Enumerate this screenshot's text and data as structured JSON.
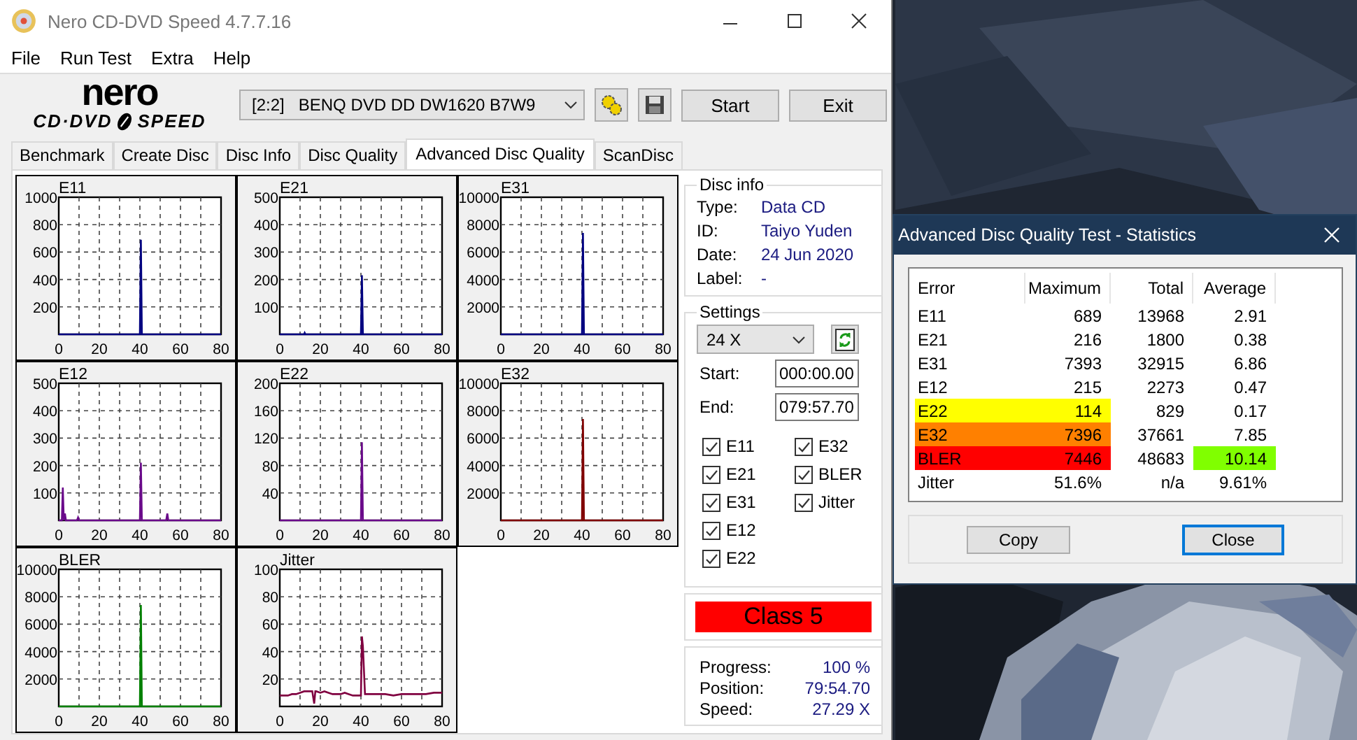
{
  "window": {
    "title": "Nero CD-DVD Speed 4.7.7.16"
  },
  "menu": [
    "File",
    "Run Test",
    "Extra",
    "Help"
  ],
  "logo": {
    "brand": "nero",
    "left": "CD·DVD",
    "right": "SPEED"
  },
  "toolbar": {
    "drive": "[2:2]   BENQ DVD DD DW1620 B7W9",
    "buttons": [
      "Start",
      "Exit"
    ]
  },
  "tabs": [
    {
      "label": "Benchmark",
      "selected": false
    },
    {
      "label": "Create Disc",
      "selected": false
    },
    {
      "label": "Disc Info",
      "selected": false
    },
    {
      "label": "Disc Quality",
      "selected": false
    },
    {
      "label": "Advanced Disc Quality",
      "selected": true
    },
    {
      "label": "ScanDisc",
      "selected": false
    }
  ],
  "charts": [
    {
      "chart_data": {
        "type": "line",
        "title": "E11",
        "x": [
          0,
          40,
          40.5,
          41,
          80
        ],
        "series": [
          {
            "color": "#000080",
            "values": [
              0,
              0,
              690,
              0,
              0
            ]
          }
        ],
        "grid": true,
        "xlim": [
          0,
          80
        ],
        "ylim": [
          0,
          1000
        ],
        "xticks": [
          0,
          20,
          40,
          60,
          80
        ],
        "yticks": [
          200,
          400,
          600,
          800,
          1000
        ]
      }
    },
    {
      "chart_data": {
        "type": "line",
        "title": "E21",
        "x": [
          0,
          12,
          12.3,
          12.6,
          40,
          40.5,
          41,
          80
        ],
        "series": [
          {
            "color": "#000080",
            "values": [
              0,
              0,
              5,
              0,
              0,
              216,
              0,
              0
            ]
          }
        ],
        "grid": true,
        "xlim": [
          0,
          80
        ],
        "ylim": [
          0,
          500
        ],
        "xticks": [
          0,
          20,
          40,
          60,
          80
        ],
        "yticks": [
          100,
          200,
          300,
          400,
          500
        ]
      }
    },
    {
      "chart_data": {
        "type": "line",
        "title": "E31",
        "x": [
          0,
          40,
          40.5,
          41,
          80
        ],
        "series": [
          {
            "color": "#000080",
            "values": [
              0,
              0,
              7400,
              0,
              0
            ]
          }
        ],
        "grid": true,
        "xlim": [
          0,
          80
        ],
        "ylim": [
          0,
          10000
        ],
        "xticks": [
          0,
          20,
          40,
          60,
          80
        ],
        "yticks": [
          2000,
          4000,
          6000,
          8000,
          10000
        ]
      }
    },
    {
      "chart_data": {
        "type": "line",
        "title": "E12",
        "x": [
          0,
          1.5,
          2,
          2.5,
          3,
          3.5,
          9,
          9.5,
          10,
          40,
          40.5,
          41,
          53,
          53.5,
          54,
          80
        ],
        "series": [
          {
            "color": "#6a0a8a",
            "values": [
              0,
              0,
              120,
              0,
              25,
              0,
              0,
              10,
              0,
              0,
              210,
              0,
              0,
              25,
              0,
              0
            ]
          }
        ],
        "grid": true,
        "xlim": [
          0,
          80
        ],
        "ylim": [
          0,
          500
        ],
        "xticks": [
          0,
          20,
          40,
          60,
          80
        ],
        "yticks": [
          100,
          200,
          300,
          400,
          500
        ]
      }
    },
    {
      "chart_data": {
        "type": "line",
        "title": "E22",
        "x": [
          0,
          40,
          40.5,
          41,
          80
        ],
        "series": [
          {
            "color": "#6a0a8a",
            "values": [
              0,
              0,
              114,
              0,
              0
            ]
          }
        ],
        "grid": true,
        "xlim": [
          0,
          80
        ],
        "ylim": [
          0,
          200
        ],
        "xticks": [
          0,
          20,
          40,
          60,
          80
        ],
        "yticks": [
          40,
          80,
          120,
          160,
          200
        ]
      }
    },
    {
      "chart_data": {
        "type": "line",
        "title": "E32",
        "x": [
          0,
          40,
          40.5,
          41,
          80
        ],
        "series": [
          {
            "color": "#800000",
            "values": [
              0,
              0,
              7400,
              0,
              0
            ]
          }
        ],
        "grid": true,
        "xlim": [
          0,
          80
        ],
        "ylim": [
          0,
          10000
        ],
        "xticks": [
          0,
          20,
          40,
          60,
          80
        ],
        "yticks": [
          2000,
          4000,
          6000,
          8000,
          10000
        ]
      }
    },
    {
      "chart_data": {
        "type": "line",
        "title": "BLER",
        "x": [
          0,
          40,
          40.5,
          41,
          80
        ],
        "series": [
          {
            "color": "#008000",
            "values": [
              0,
              0,
              7400,
              0,
              0
            ]
          }
        ],
        "grid": true,
        "xlim": [
          0,
          80
        ],
        "ylim": [
          0,
          10000
        ],
        "xticks": [
          0,
          20,
          40,
          60,
          80
        ],
        "yticks": [
          2000,
          4000,
          6000,
          8000,
          10000
        ]
      }
    },
    {
      "chart_data": {
        "type": "line",
        "title": "Jitter",
        "x": [
          0,
          2,
          4,
          6,
          8,
          10,
          12,
          14,
          16,
          17,
          17.5,
          18,
          20,
          22,
          24,
          26,
          28,
          30,
          32,
          34,
          36,
          38,
          40,
          40.5,
          41,
          42,
          43,
          44,
          48,
          52,
          56,
          60,
          64,
          68,
          72,
          76,
          80
        ],
        "series": [
          {
            "color": "#800040",
            "values": [
              8,
              8,
              8,
              9,
              9,
              10,
              11,
              11,
              11,
              2,
              11,
              11,
              10,
              11,
              10,
              9,
              9,
              9,
              10,
              9,
              8,
              8,
              8,
              51,
              44,
              9,
              9,
              9,
              9,
              9,
              8,
              9,
              9,
              9,
              9,
              10,
              10
            ]
          }
        ],
        "grid": true,
        "xlim": [
          0,
          80
        ],
        "ylim": [
          0,
          100
        ],
        "xticks": [
          0,
          20,
          40,
          60,
          80
        ],
        "yticks": [
          20,
          40,
          60,
          80,
          100
        ]
      }
    }
  ],
  "disc_info": {
    "title": "Disc info",
    "fields": [
      {
        "label": "Type:",
        "value": "Data CD"
      },
      {
        "label": "ID:",
        "value": "Taiyo Yuden"
      },
      {
        "label": "Date:",
        "value": "24 Jun 2020"
      },
      {
        "label": "Label:",
        "value": "-"
      }
    ]
  },
  "settings": {
    "title": "Settings",
    "speed": "24 X",
    "fields": [
      {
        "label": "Start:",
        "value": "000:00.00"
      },
      {
        "label": "End:",
        "value": "079:57.70"
      }
    ],
    "checks": [
      {
        "label": "E11",
        "checked": true
      },
      {
        "label": "E21",
        "checked": true
      },
      {
        "label": "E31",
        "checked": true
      },
      {
        "label": "E12",
        "checked": true
      },
      {
        "label": "E22",
        "checked": true
      },
      {
        "label": "E32",
        "checked": true
      },
      {
        "label": "BLER",
        "checked": true
      },
      {
        "label": "Jitter",
        "checked": true
      }
    ]
  },
  "quality_class": {
    "label": "Class 5",
    "color": "#ff0000"
  },
  "progress": [
    {
      "label": "Progress:",
      "value": "100 %"
    },
    {
      "label": "Position:",
      "value": "79:54.70"
    },
    {
      "label": "Speed:",
      "value": "27.29 X"
    }
  ],
  "statistics_dialog": {
    "title": "Advanced Disc Quality Test - Statistics",
    "columns": [
      "Error",
      "Maximum",
      "Total",
      "Average"
    ],
    "rows": [
      {
        "cells": [
          {
            "text": "E11"
          },
          {
            "text": "689"
          },
          {
            "text": "13968"
          },
          {
            "text": "2.91"
          }
        ]
      },
      {
        "cells": [
          {
            "text": "E21"
          },
          {
            "text": "216"
          },
          {
            "text": "1800"
          },
          {
            "text": "0.38"
          }
        ]
      },
      {
        "cells": [
          {
            "text": "E31"
          },
          {
            "text": "7393"
          },
          {
            "text": "32915"
          },
          {
            "text": "6.86"
          }
        ]
      },
      {
        "cells": [
          {
            "text": "E12"
          },
          {
            "text": "215"
          },
          {
            "text": "2273"
          },
          {
            "text": "0.47"
          }
        ]
      },
      {
        "cells": [
          {
            "text": "E22",
            "color": "#ffff00"
          },
          {
            "text": "114",
            "color": "#ffff00"
          },
          {
            "text": "829"
          },
          {
            "text": "0.17"
          }
        ]
      },
      {
        "cells": [
          {
            "text": "E32",
            "color": "#ff8000"
          },
          {
            "text": "7396",
            "color": "#ff8000"
          },
          {
            "text": "37661"
          },
          {
            "text": "7.85"
          }
        ]
      },
      {
        "cells": [
          {
            "text": "BLER",
            "color": "#ff0000"
          },
          {
            "text": "7446",
            "color": "#ff0000"
          },
          {
            "text": "48683"
          },
          {
            "text": "10.14",
            "color": "#80ff00"
          }
        ]
      },
      {
        "cells": [
          {
            "text": "Jitter"
          },
          {
            "text": "51.6%"
          },
          {
            "text": "n/a"
          },
          {
            "text": "9.61%"
          }
        ]
      }
    ],
    "buttons": [
      {
        "label": "Copy",
        "default": false
      },
      {
        "label": "Close",
        "default": true
      }
    ]
  }
}
